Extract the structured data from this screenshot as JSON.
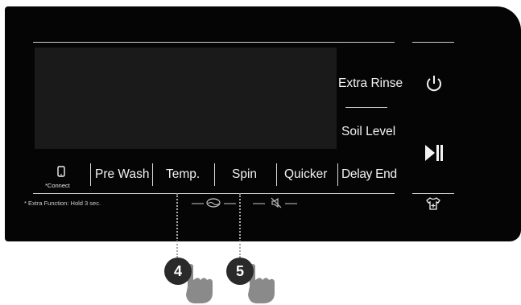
{
  "side": {
    "extra_rinse": "Extra Rinse",
    "soil_level": "Soil Level"
  },
  "buttons": {
    "connect": "*Connect",
    "pre_wash": "Pre Wash",
    "temp": "Temp.",
    "spin": "Spin",
    "quicker": "Quicker",
    "delay_end": "Delay End"
  },
  "note": "* Extra Function: Hold 3 sec.",
  "steps": [
    "4",
    "5"
  ],
  "icons": [
    "phone-icon",
    "power-icon",
    "play-pause-icon",
    "shirt-plus-icon",
    "no-crease-icon",
    "mute-icon",
    "hand-icon"
  ]
}
